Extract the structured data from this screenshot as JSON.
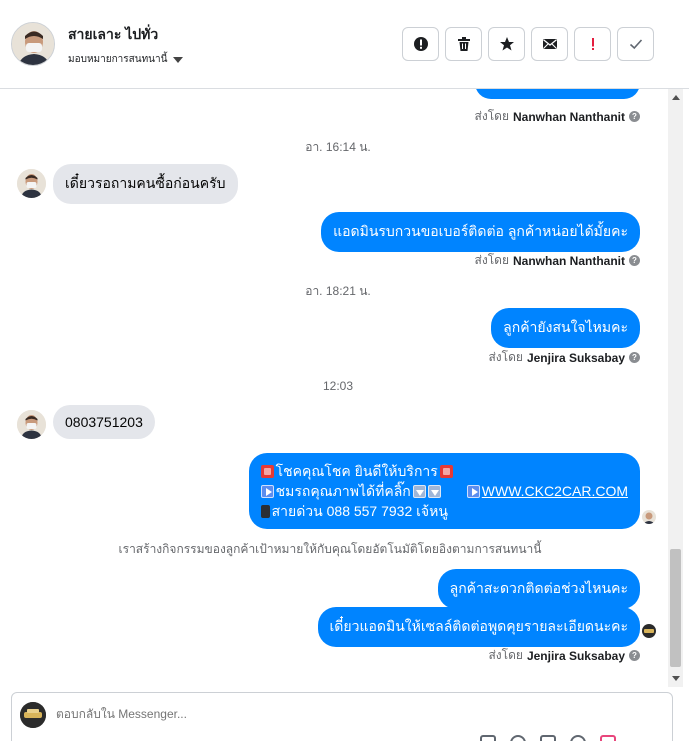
{
  "header": {
    "contact_name": "สายเลาะ ไปทั่ว",
    "assign_label": "มอบหมายการสนทนานี้",
    "tools": [
      {
        "name": "report-icon",
        "label": "!"
      },
      {
        "name": "trash-icon"
      },
      {
        "name": "star-icon"
      },
      {
        "name": "mail-icon"
      },
      {
        "name": "exclamation-icon",
        "label": "!"
      },
      {
        "name": "checkmark-icon"
      }
    ]
  },
  "thread": {
    "sent_by_prefix": "ส่งโดย",
    "messages": [
      {
        "id": "m0",
        "direction": "out",
        "sender": "Nanwhan Nanthanit"
      },
      {
        "id": "t1",
        "type": "timestamp",
        "text": "อา. 16:14 น."
      },
      {
        "id": "m1",
        "direction": "in",
        "text": "เดี๋ยวรอถามคนซื้อก่อนครับ"
      },
      {
        "id": "m2",
        "direction": "out",
        "text": "แอดมินรบกวนขอเบอร์ติดต่อ ลูกค้าหน่อยได้มั้ยคะ",
        "sender": "Nanwhan Nanthanit"
      },
      {
        "id": "t2",
        "type": "timestamp",
        "text": "อา. 18:21 น."
      },
      {
        "id": "m3",
        "direction": "out",
        "text": "ลูกค้ายังสนใจไหมคะ",
        "sender": "Jenjira Suksabay"
      },
      {
        "id": "t3",
        "type": "timestamp",
        "text": "12:03"
      },
      {
        "id": "m4",
        "direction": "in",
        "text": "0803751203"
      },
      {
        "id": "m5",
        "direction": "out",
        "type": "rich",
        "line1": "โชคคุณโชค ยินดีให้บริการ",
        "line2": "ชมรถคุณภาพได้ที่คลิ๊ก",
        "link": "WWW.CKC2CAR.COM",
        "line3": "สายด่วน 088 557 7932 เจ้หนู"
      },
      {
        "id": "n1",
        "type": "system",
        "text": "เราสร้างกิจกรรมของลูกค้าเป้าหมายให้กับคุณโดยอัตโนมัติโดยอิงตามการสนทนานี้"
      },
      {
        "id": "m6",
        "direction": "out",
        "text": "ลูกค้าสะดวกติดต่อช่วงไหนคะ"
      },
      {
        "id": "m7",
        "direction": "out",
        "text": "เดี๋ยวแอดมินให้เซลล์ติดต่อพูดคุยรายละเอียดนะคะ",
        "sender": "Jenjira Suksabay"
      }
    ]
  },
  "composer": {
    "placeholder": "ตอบกลับใน Messenger..."
  },
  "colors": {
    "outgoing_bubble": "#0084ff",
    "incoming_bubble": "#e4e6eb",
    "muted_text": "#65676b"
  }
}
